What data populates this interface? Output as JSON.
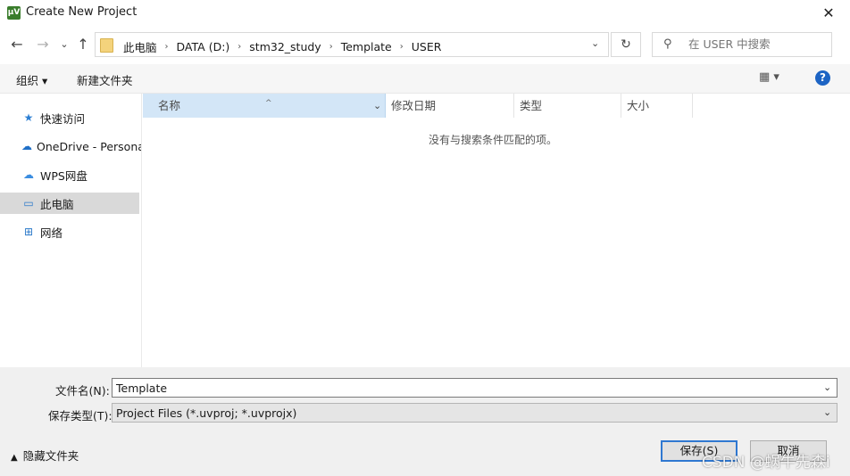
{
  "window": {
    "title": "Create New Project",
    "app_icon": "µV",
    "close_glyph": "✕"
  },
  "nav": {
    "back": "←",
    "forward": "→",
    "recent": "⌄",
    "up": "↑",
    "refresh": "↻"
  },
  "address": {
    "crumbs": [
      "此电脑",
      "DATA (D:)",
      "stm32_study",
      "Template",
      "USER"
    ],
    "separator": "›"
  },
  "search": {
    "placeholder": "在 USER 中搜索"
  },
  "toolbar": {
    "organize": "组织 ▾",
    "new_folder": "新建文件夹",
    "view": "▦ ▾",
    "help": "?"
  },
  "sidebar": {
    "items": [
      {
        "label": "快速访问",
        "icon": "★"
      },
      {
        "label": "OneDrive - Personal",
        "icon": "☁"
      },
      {
        "label": "WPS网盘",
        "icon": "☁"
      },
      {
        "label": "此电脑",
        "icon": "▭"
      },
      {
        "label": "网络",
        "icon": "⊞"
      }
    ]
  },
  "columns": {
    "name": "名称",
    "date": "修改日期",
    "type": "类型",
    "size": "大小"
  },
  "list": {
    "empty_message": "没有与搜索条件匹配的项。"
  },
  "form": {
    "filename_label": "文件名(N):",
    "filename_value": "Template",
    "filetype_label": "保存类型(T):",
    "filetype_value": "Project Files (*.uvproj; *.uvprojx)"
  },
  "footer": {
    "hide_folders": "隐藏文件夹",
    "save": "保存(S)",
    "cancel": "取消"
  },
  "watermark": "CSDN @蜗牛先森i",
  "colors": {
    "accent": "#2f78d1",
    "selected_header": "#d3e6f7",
    "help": "#1d64c4"
  }
}
